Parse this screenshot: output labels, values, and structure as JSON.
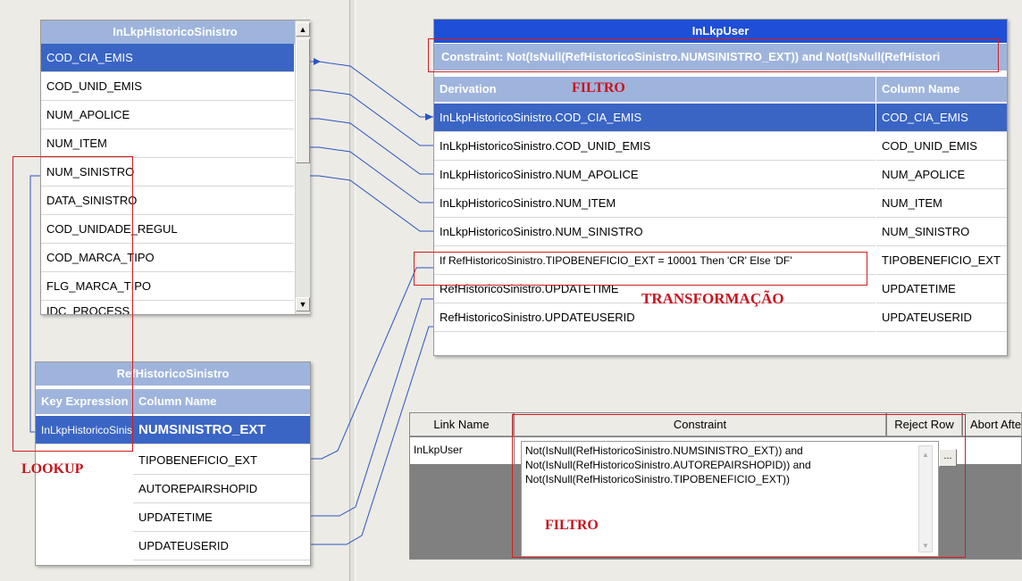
{
  "lookup_table": {
    "title": "InLkpHistoricoSinistro",
    "rows": [
      "COD_CIA_EMIS",
      "COD_UNID_EMIS",
      "NUM_APOLICE",
      "NUM_ITEM",
      "NUM_SINISTRO",
      "DATA_SINISTRO",
      "COD_UNIDADE_REGUL",
      "COD_MARCA_TIPO",
      "FLG_MARCA_TIPO",
      "IDC_PROCESS"
    ]
  },
  "ref_table": {
    "title": "RefHistoricoSinistro",
    "col_key": "Key Expression",
    "col_name": "Column Name",
    "key_value": "InLkpHistoricoSinistro.NUM_SINISTRO",
    "rows": [
      "NUMSINISTRO_EXT",
      "TIPOBENEFICIO_EXT",
      "AUTOREPAIRSHOPID",
      "UPDATETIME",
      "UPDATEUSERID"
    ]
  },
  "user_table": {
    "title": "InLkpUser",
    "constraint": "Constraint: Not(IsNull(RefHistoricoSinistro.NUMSINISTRO_EXT)) and Not(IsNull(RefHistori",
    "col_derivation": "Derivation",
    "col_name": "Column Name",
    "rows": [
      {
        "derivation": "InLkpHistoricoSinistro.COD_CIA_EMIS",
        "column": "COD_CIA_EMIS"
      },
      {
        "derivation": "InLkpHistoricoSinistro.COD_UNID_EMIS",
        "column": "COD_UNID_EMIS"
      },
      {
        "derivation": "InLkpHistoricoSinistro.NUM_APOLICE",
        "column": "NUM_APOLICE"
      },
      {
        "derivation": "InLkpHistoricoSinistro.NUM_ITEM",
        "column": "NUM_ITEM"
      },
      {
        "derivation": "InLkpHistoricoSinistro.NUM_SINISTRO",
        "column": "NUM_SINISTRO"
      },
      {
        "derivation": "If RefHistoricoSinistro.TIPOBENEFICIO_EXT = 10001 Then 'CR' Else 'DF'",
        "column": "TIPOBENEFICIO_EXT"
      },
      {
        "derivation": "RefHistoricoSinistro.UPDATETIME",
        "column": "UPDATETIME"
      },
      {
        "derivation": "RefHistoricoSinistro.UPDATEUSERID",
        "column": "UPDATEUSERID"
      }
    ]
  },
  "link_grid": {
    "headers": {
      "link_name": "Link Name",
      "constraint": "Constraint",
      "reject_row": "Reject Row",
      "abort_after": "Abort Afte"
    },
    "link_name": "InLkpUser",
    "constraint_lines": [
      "Not(IsNull(RefHistoricoSinistro.NUMSINISTRO_EXT)) and",
      "Not(IsNull(RefHistoricoSinistro.AUTOREPAIRSHOPID)) and",
      "Not(IsNull(RefHistoricoSinistro.TIPOBENEFICIO_EXT))"
    ],
    "ellipsis": "..."
  },
  "annotations": {
    "filtro_top": "FILTRO",
    "transformacao": "TRANSFORMAÇÃO",
    "lookup": "LOOKUP",
    "filtro_bottom": "FILTRO"
  },
  "colors": {
    "selection": "#3a65c4",
    "header_light": "#9fb4dc",
    "title_dark": "#1f4fd6",
    "annotation_red": "#c8141e",
    "link_line": "#2a55c0"
  }
}
